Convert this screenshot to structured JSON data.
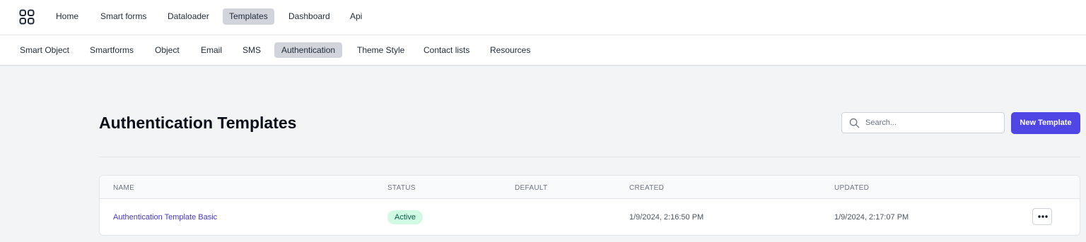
{
  "topnav": {
    "items": [
      {
        "label": "Home",
        "active": false
      },
      {
        "label": "Smart forms",
        "active": false
      },
      {
        "label": "Dataloader",
        "active": false
      },
      {
        "label": "Templates",
        "active": true
      },
      {
        "label": "Dashboard",
        "active": false
      },
      {
        "label": "Api",
        "active": false
      }
    ],
    "app_icon": "grid-apps-icon"
  },
  "subnav": {
    "items": [
      {
        "label": "Smart Object",
        "active": false
      },
      {
        "label": "Smartforms",
        "active": false
      },
      {
        "label": "Object",
        "active": false
      },
      {
        "label": "Email",
        "active": false
      },
      {
        "label": "SMS",
        "active": false
      },
      {
        "label": "Authentication",
        "active": true
      },
      {
        "label": "Theme Style",
        "active": false
      },
      {
        "label": "Contact lists",
        "active": false
      },
      {
        "label": "Resources",
        "active": false
      }
    ]
  },
  "main": {
    "title": "Authentication Templates",
    "search": {
      "placeholder": "Search...",
      "value": "",
      "icon": "search-icon"
    },
    "new_button_label": "New Template"
  },
  "table": {
    "columns": [
      "NAME",
      "STATUS",
      "DEFAULT",
      "CREATED",
      "UPDATED"
    ],
    "rows": [
      {
        "name": "Authentication Template Basic",
        "status": "Active",
        "default": "",
        "created": "1/9/2024, 2:16:50 PM",
        "updated": "1/9/2024, 2:17:07 PM"
      }
    ]
  },
  "colors": {
    "accent": "#4f46e5",
    "active_badge_bg": "#d1fae5",
    "active_badge_text": "#065f46",
    "link": "#4338ca"
  }
}
